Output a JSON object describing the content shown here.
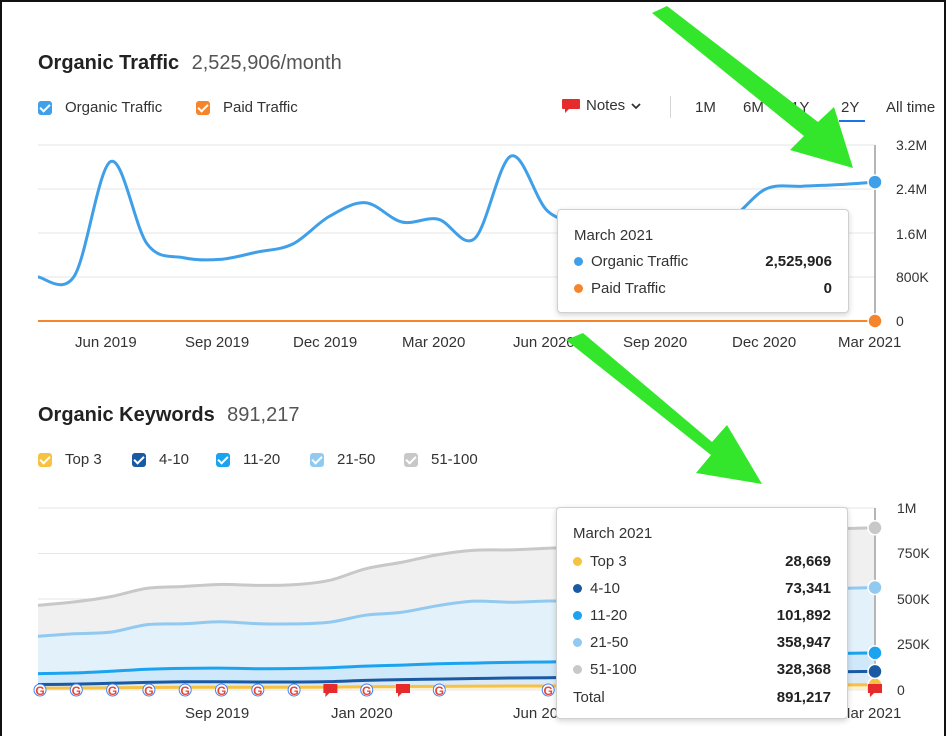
{
  "traffic": {
    "title": "Organic Traffic",
    "metric": "2,525,906/month",
    "legend": [
      {
        "label": "Organic Traffic",
        "color": "#3f9fe8"
      },
      {
        "label": "Paid Traffic",
        "color": "#f5842a"
      }
    ],
    "notes_label": "Notes",
    "ranges": [
      "1M",
      "6M",
      "1Y",
      "2Y",
      "All time"
    ],
    "active_range": "2Y",
    "tooltip": {
      "date": "March 2021",
      "rows": [
        {
          "name": "Organic Traffic",
          "value": "2,525,906",
          "color": "#3f9fe8"
        },
        {
          "name": "Paid Traffic",
          "value": "0",
          "color": "#f5842a"
        }
      ]
    }
  },
  "keywords": {
    "title": "Organic Keywords",
    "metric": "891,217",
    "legend": [
      {
        "label": "Top 3",
        "color": "#f6c244"
      },
      {
        "label": "4-10",
        "color": "#1a5aa3"
      },
      {
        "label": "11-20",
        "color": "#1ba3f0"
      },
      {
        "label": "21-50",
        "color": "#92c9f0"
      },
      {
        "label": "51-100",
        "color": "#c8c8c8"
      }
    ],
    "tooltip": {
      "date": "March 2021",
      "rows": [
        {
          "name": "Top 3",
          "value": "28,669",
          "color": "#f6c244"
        },
        {
          "name": "4-10",
          "value": "73,341",
          "color": "#1a5aa3"
        },
        {
          "name": "11-20",
          "value": "101,892",
          "color": "#1ba3f0"
        },
        {
          "name": "21-50",
          "value": "358,947",
          "color": "#92c9f0"
        },
        {
          "name": "51-100",
          "value": "328,368",
          "color": "#c8c8c8"
        }
      ],
      "total_label": "Total",
      "total_value": "891,217"
    }
  },
  "chart_data": [
    {
      "type": "line",
      "title": "Organic Traffic",
      "x": [
        "Apr 2019",
        "May 2019",
        "Jun 2019",
        "Jul 2019",
        "Aug 2019",
        "Sep 2019",
        "Oct 2019",
        "Nov 2019",
        "Dec 2019",
        "Jan 2020",
        "Feb 2020",
        "Mar 2020",
        "Apr 2020",
        "May 2020",
        "Jun 2020",
        "Jul 2020",
        "Aug 2020",
        "Sep 2020",
        "Oct 2020",
        "Nov 2020",
        "Dec 2020",
        "Jan 2021",
        "Feb 2021",
        "Mar 2021"
      ],
      "x_tick_labels": [
        "Jun 2019",
        "Sep 2019",
        "Dec 2019",
        "Mar 2020",
        "Jun 2020",
        "Sep 2020",
        "Dec 2020",
        "Mar 2021"
      ],
      "y_tick_labels": [
        "3.2M",
        "2.4M",
        "1.6M",
        "800K",
        "0"
      ],
      "ylim": [
        0,
        3200000
      ],
      "series": [
        {
          "name": "Organic Traffic",
          "color": "#3f9fe8",
          "values": [
            800000,
            820000,
            2900000,
            1400000,
            1150000,
            1120000,
            1250000,
            1400000,
            1900000,
            2150000,
            1800000,
            1850000,
            1500000,
            3000000,
            2000000,
            1800000,
            1750000,
            1700000,
            1750000,
            1850000,
            2400000,
            2450000,
            2480000,
            2525906
          ]
        },
        {
          "name": "Paid Traffic",
          "color": "#f5842a",
          "values": [
            0,
            0,
            0,
            0,
            0,
            0,
            0,
            0,
            0,
            0,
            0,
            0,
            0,
            0,
            0,
            0,
            0,
            0,
            0,
            0,
            0,
            0,
            0,
            0
          ]
        }
      ],
      "grid": true
    },
    {
      "type": "area",
      "title": "Organic Keywords",
      "x": [
        "Apr 2019",
        "May 2019",
        "Jun 2019",
        "Jul 2019",
        "Aug 2019",
        "Sep 2019",
        "Oct 2019",
        "Nov 2019",
        "Dec 2019",
        "Jan 2020",
        "Feb 2020",
        "Mar 2020",
        "Apr 2020",
        "May 2020",
        "Jun 2020",
        "Jul 2020",
        "Aug 2020",
        "Sep 2020",
        "Oct 2020",
        "Nov 2020",
        "Dec 2020",
        "Jan 2021",
        "Feb 2021",
        "Mar 2021"
      ],
      "x_tick_labels": [
        "Sep 2019",
        "Jan 2020",
        "Jun 2020",
        "Mar 2021"
      ],
      "y_tick_labels": [
        "1M",
        "750K",
        "500K",
        "250K",
        "0"
      ],
      "ylim": [
        0,
        1000000
      ],
      "stacked": true,
      "series": [
        {
          "name": "Top 3",
          "color": "#f6c244",
          "values": [
            10000,
            11000,
            12000,
            14000,
            15000,
            15000,
            15000,
            15000,
            16000,
            18000,
            19000,
            20000,
            21000,
            22000,
            22000,
            23000,
            24000,
            25000,
            26000,
            27000,
            27000,
            28000,
            28000,
            28669
          ]
        },
        {
          "name": "4-10",
          "color": "#1a5aa3",
          "values": [
            20000,
            21000,
            25000,
            28000,
            30000,
            30000,
            29000,
            29000,
            30000,
            35000,
            38000,
            40000,
            42000,
            44000,
            45000,
            48000,
            50000,
            55000,
            60000,
            63000,
            66000,
            70000,
            72000,
            73341
          ]
        },
        {
          "name": "11-20",
          "color": "#1ba3f0",
          "values": [
            60000,
            62000,
            66000,
            72000,
            74000,
            75000,
            73000,
            74000,
            76000,
            78000,
            80000,
            84000,
            85000,
            86000,
            87000,
            88000,
            89000,
            92000,
            95000,
            97000,
            99000,
            100000,
            101000,
            101892
          ]
        },
        {
          "name": "21-50",
          "color": "#92c9f0",
          "values": [
            205000,
            215000,
            215000,
            245000,
            245000,
            255000,
            248000,
            245000,
            250000,
            280000,
            290000,
            320000,
            340000,
            330000,
            335000,
            330000,
            332000,
            335000,
            340000,
            345000,
            350000,
            355000,
            357000,
            358947
          ]
        },
        {
          "name": "51-100",
          "color": "#c8c8c8",
          "values": [
            170000,
            175000,
            195000,
            200000,
            205000,
            205000,
            210000,
            215000,
            230000,
            255000,
            275000,
            280000,
            280000,
            288000,
            290000,
            298000,
            300000,
            305000,
            310000,
            315000,
            320000,
            325000,
            328000,
            328368
          ]
        }
      ],
      "grid": true
    }
  ]
}
